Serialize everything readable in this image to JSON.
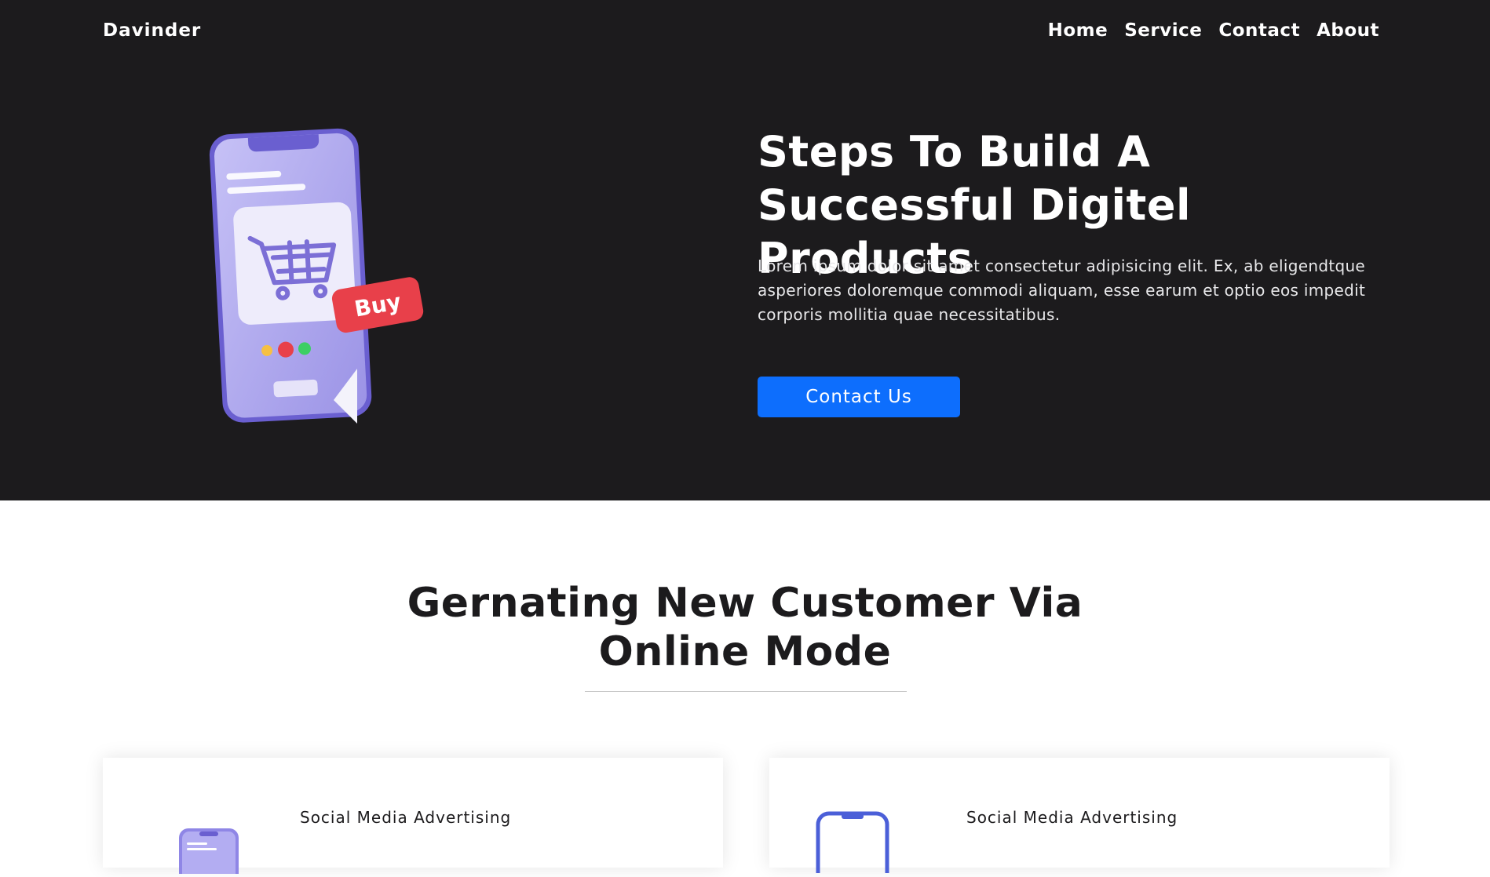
{
  "header": {
    "brand": "Davinder",
    "nav": [
      "Home",
      "Service",
      "Contact",
      "About"
    ]
  },
  "hero": {
    "title_line1": "Steps To Build A",
    "title_line2": "Successful Digitel Products",
    "description": "Lorem ipsum dolor sit amet consectetur adipisicing elit. Ex, ab eligendtque asperiores doloremque commodi aliquam, esse earum et optio eos impedit corporis mollitia quae necessitatibus.",
    "cta_label": "Contact Us",
    "illustration": {
      "icon": "phone-shopping-cart-icon",
      "badge_text": "Buy",
      "colors": {
        "phone": "#a9a3ee",
        "phone_frame": "#6a5fd0",
        "badge": "#e8404a",
        "accent": "#0d6efd"
      }
    }
  },
  "section": {
    "title_line1": "Gernating New Customer Via",
    "title_line2": "Online Mode"
  },
  "cards": [
    {
      "title": "Social Media Advertising",
      "icon": "phone-icon"
    },
    {
      "title": "Social Media Advertising",
      "icon": "phone-outline-icon"
    }
  ]
}
